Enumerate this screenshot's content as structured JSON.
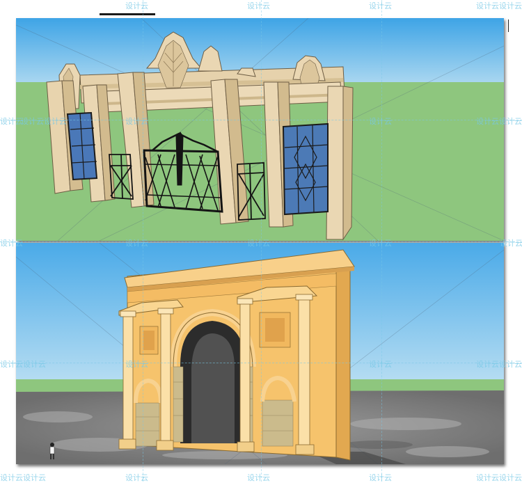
{
  "watermark": {
    "text": "设计云",
    "text_double": "设计云设计云",
    "color": "#78c8e6"
  },
  "scenes": {
    "top": {
      "description_icon": "stone-gate-with-iron-fence-render",
      "sky_color": "#5cb4e8",
      "ground_color": "#8ec67e",
      "stone_color": "#e9d6b2",
      "iron_color": "#1d1d1d",
      "glass_color": "#4c78b8"
    },
    "bottom": {
      "description_icon": "triumphal-arch-render",
      "sky_color": "#5cb4e8",
      "ground_color": "#8ec67e",
      "pavement_color": "#8e8e8e",
      "arch_color": "#f4c06a",
      "stone_wall_color": "#c9b98c"
    }
  }
}
